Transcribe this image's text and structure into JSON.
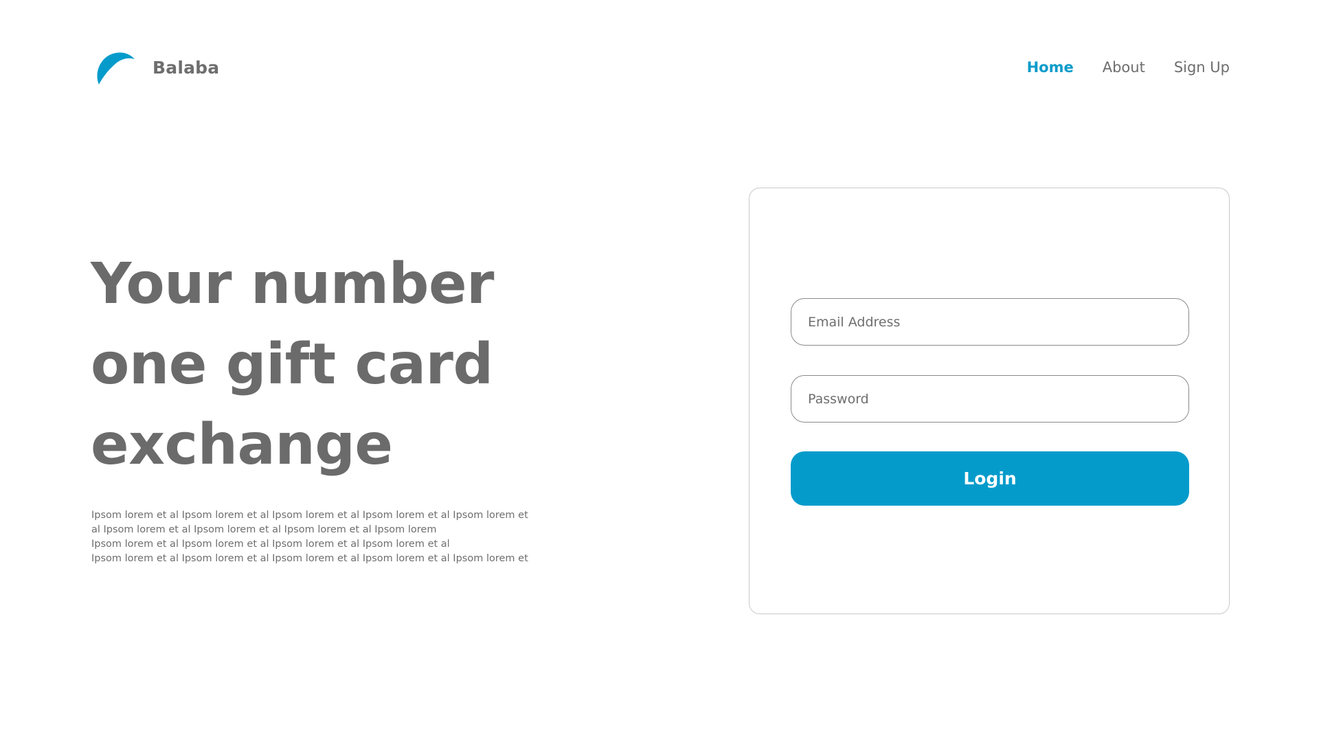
{
  "brand": {
    "name": "Balaba",
    "logo_icon": "blue-crescent-logo",
    "accent_color": "#049bcb"
  },
  "nav": {
    "items": [
      {
        "label": "Home",
        "active": true
      },
      {
        "label": "About",
        "active": false
      },
      {
        "label": "Sign Up",
        "active": false
      }
    ]
  },
  "hero": {
    "title_lines": [
      "Your number",
      "one gift card",
      "exchange"
    ],
    "body_lines": [
      "Ipsom lorem et al Ipsom lorem et al Ipsom lorem et al Ipsom lorem et al Ipsom lorem et",
      "al Ipsom lorem et al Ipsom lorem et al Ipsom lorem et al Ipsom lorem",
      "Ipsom lorem et al Ipsom lorem et al Ipsom lorem et al Ipsom lorem et al",
      "Ipsom lorem et al Ipsom lorem et al Ipsom lorem et al Ipsom lorem et al Ipsom lorem et"
    ]
  },
  "login": {
    "email": {
      "placeholder": "Email Address",
      "value": ""
    },
    "password": {
      "placeholder": "Password",
      "value": ""
    },
    "button_label": "Login"
  }
}
